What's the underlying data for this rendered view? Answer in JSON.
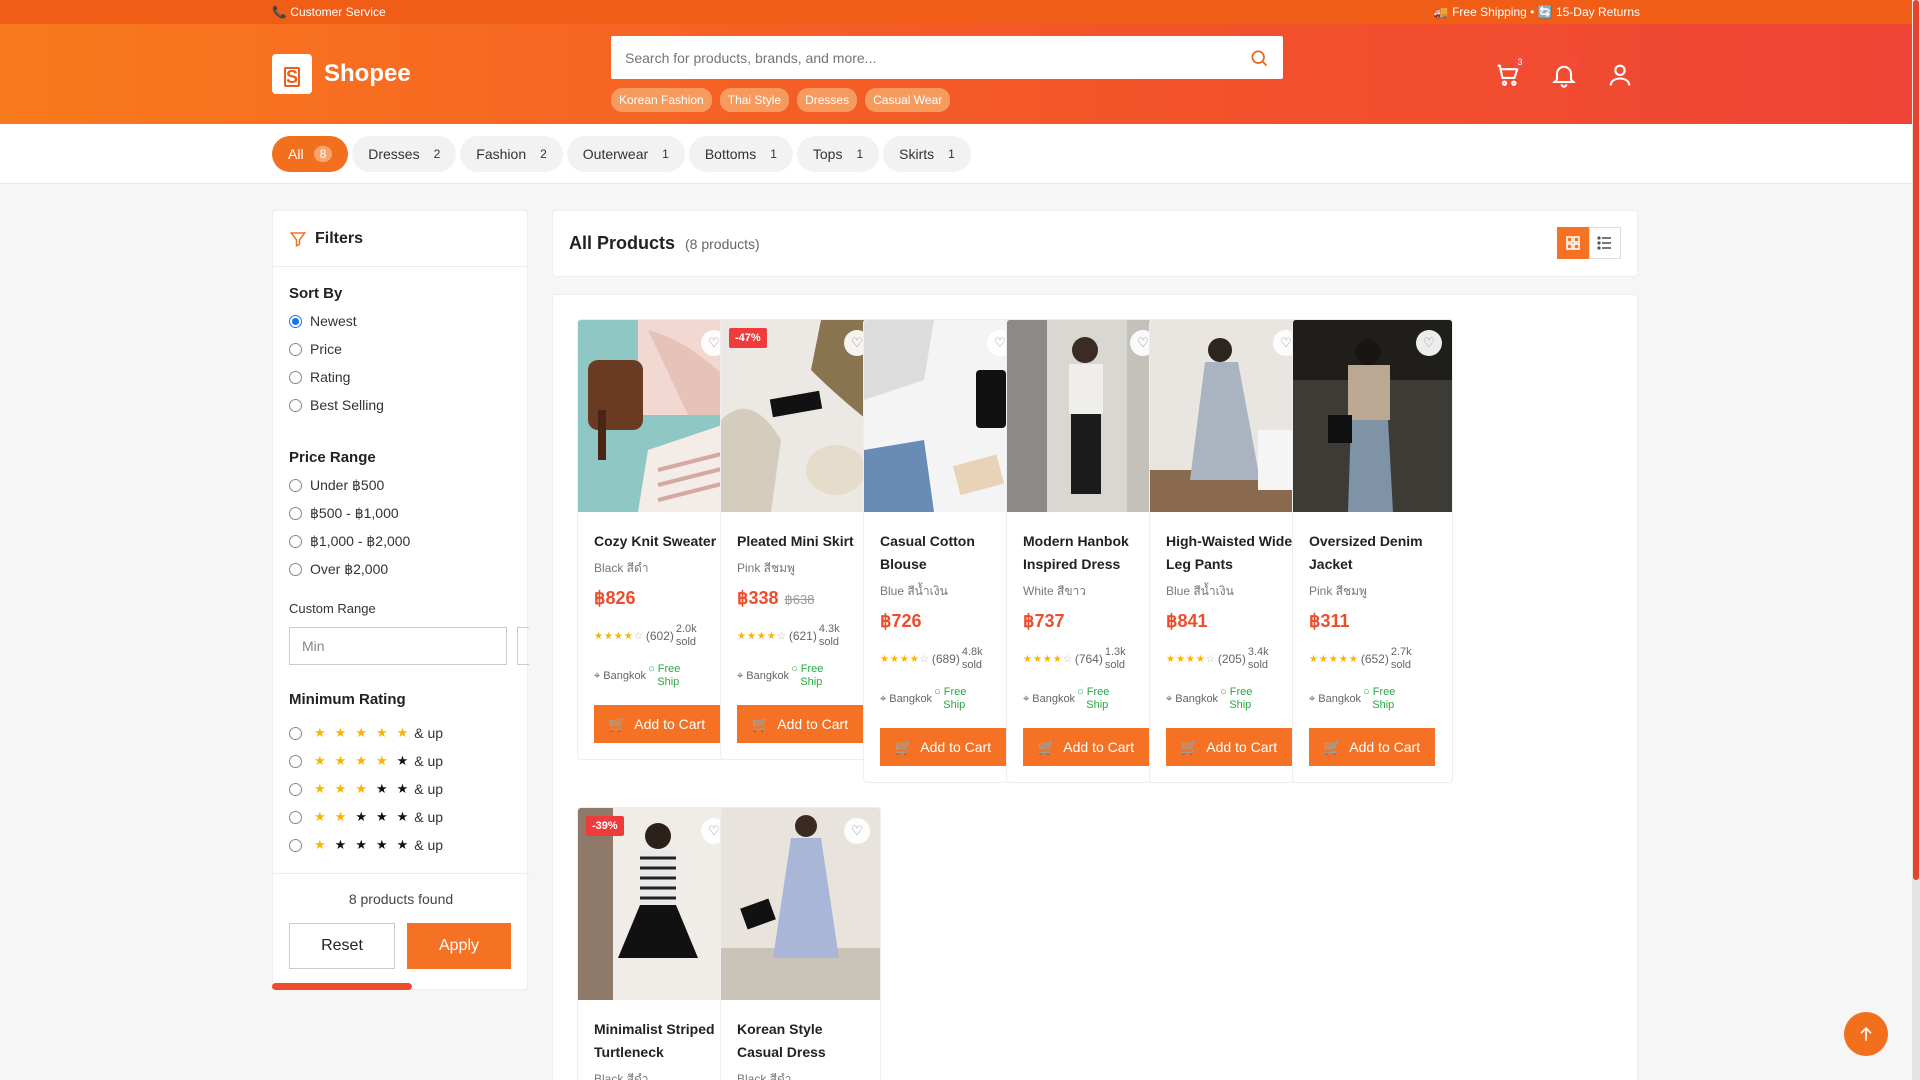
{
  "topbar": {
    "customer_service": "📞 Customer Service",
    "right_text": "🚚 Free Shipping • 🔄 15-Day Returns"
  },
  "header": {
    "brand": "Shopee",
    "search_placeholder": "Search for products, brands, and more...",
    "chips": [
      "Korean Fashion",
      "Thai Style",
      "Dresses",
      "Casual Wear"
    ],
    "cart_count": "3"
  },
  "categories": [
    {
      "label": "All",
      "count": "8"
    },
    {
      "label": "Dresses",
      "count": "2"
    },
    {
      "label": "Fashion",
      "count": "2"
    },
    {
      "label": "Outerwear",
      "count": "1"
    },
    {
      "label": "Bottoms",
      "count": "1"
    },
    {
      "label": "Tops",
      "count": "1"
    },
    {
      "label": "Skirts",
      "count": "1"
    }
  ],
  "sidebar": {
    "title": "Filters",
    "sort_title": "Sort By",
    "sort_options": [
      "Newest",
      "Price",
      "Rating",
      "Best Selling"
    ],
    "price_title": "Price Range",
    "price_options": [
      "Under ฿500",
      "฿500 - ฿1,000",
      "฿1,000 - ฿2,000",
      "Over ฿2,000"
    ],
    "custom_range": "Custom Range",
    "min_placeholder": "Min",
    "rating_title": "Minimum Rating",
    "rating_suffix": "& up",
    "found": "8 products found",
    "reset": "Reset",
    "apply": "Apply"
  },
  "main": {
    "title": "All Products",
    "count": "(8 products)"
  },
  "product_labels": {
    "add_to_cart": "Add to Cart",
    "free": "Free",
    "ship": "Ship",
    "sold": "sold"
  },
  "products": [
    {
      "name": "Cozy Knit Sweater",
      "color": "Black สีดำ",
      "price": "฿826",
      "old_price": "",
      "discount": "",
      "rating": "(602)",
      "sold": "2.0k",
      "location": "Bangkok"
    },
    {
      "name": "Pleated Mini Skirt",
      "color": "Pink สีชมพู",
      "price": "฿338",
      "old_price": "฿638",
      "discount": "-47%",
      "rating": "(621)",
      "sold": "4.3k",
      "location": "Bangkok"
    },
    {
      "name": "Casual Cotton Blouse",
      "color": "Blue สีน้ำเงิน",
      "price": "฿726",
      "old_price": "",
      "discount": "",
      "rating": "(689)",
      "sold": "4.8k",
      "location": "Bangkok"
    },
    {
      "name": "Modern Hanbok Inspired Dress",
      "color": "White สีขาว",
      "price": "฿737",
      "old_price": "",
      "discount": "",
      "rating": "(764)",
      "sold": "1.3k",
      "location": "Bangkok"
    },
    {
      "name": "High-Waisted Wide Leg Pants",
      "color": "Blue สีน้ำเงิน",
      "price": "฿841",
      "old_price": "",
      "discount": "",
      "rating": "(205)",
      "sold": "3.4k",
      "location": "Bangkok"
    },
    {
      "name": "Oversized Denim Jacket",
      "color": "Pink สีชมพู",
      "price": "฿311",
      "old_price": "",
      "discount": "",
      "rating": "(652)",
      "sold": "2.7k",
      "location": "Bangkok"
    },
    {
      "name": "Minimalist Striped Turtleneck",
      "color": "Black สีดำ",
      "price": "",
      "old_price": "",
      "discount": "-39%",
      "rating": "",
      "sold": "",
      "location": ""
    },
    {
      "name": "Korean Style Casual Dress",
      "color": "Black สีดำ",
      "price": "",
      "old_price": "",
      "discount": "",
      "rating": "",
      "sold": "",
      "location": ""
    }
  ],
  "colors": {
    "brand": "#f57224",
    "price": "#ee4d2d",
    "free_ship": "#27a844",
    "star": "#f8b400"
  }
}
